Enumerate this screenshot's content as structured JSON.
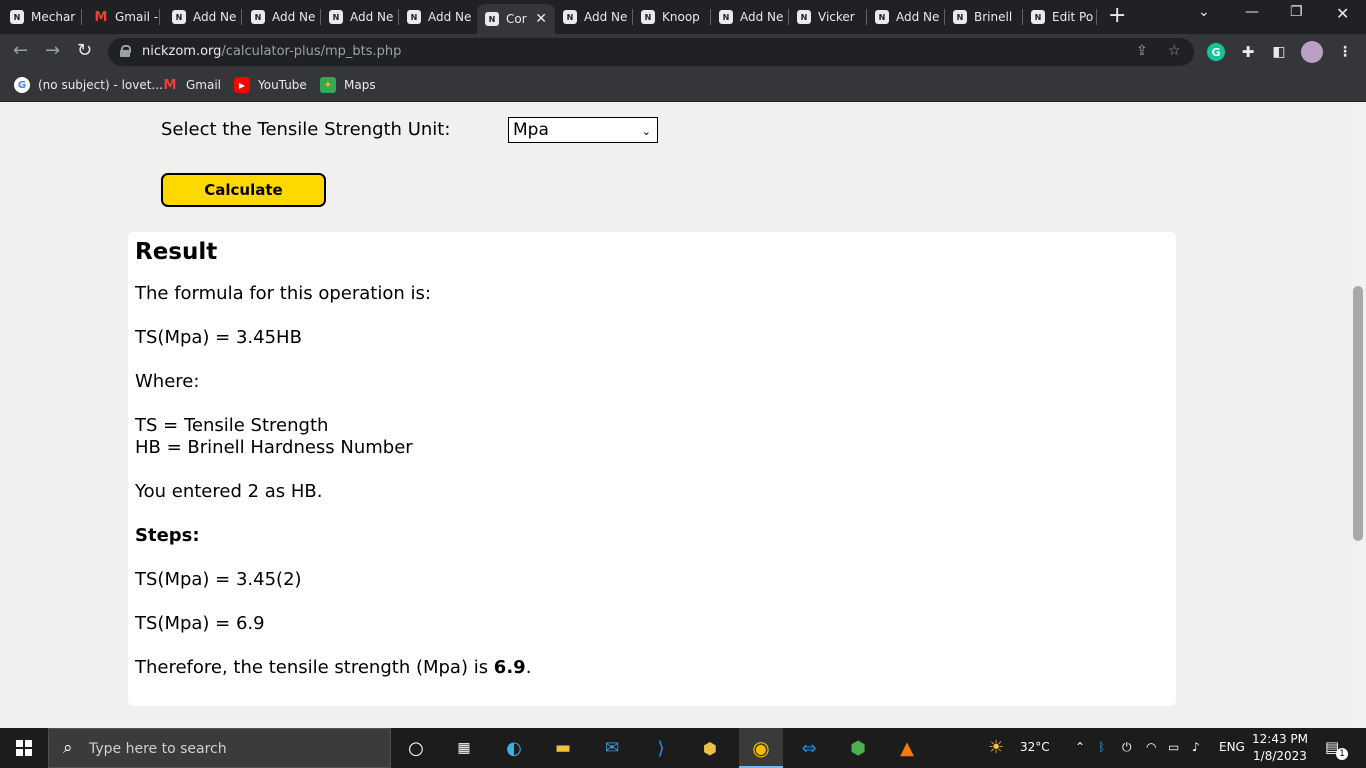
{
  "browser": {
    "tabs": [
      {
        "label": "Mechar",
        "icon": "nickzom"
      },
      {
        "label": "Gmail -",
        "icon": "gmail"
      },
      {
        "label": "Add Ne",
        "icon": "nickzom"
      },
      {
        "label": "Add Ne",
        "icon": "nickzom"
      },
      {
        "label": "Add Ne",
        "icon": "nickzom"
      },
      {
        "label": "Add Ne",
        "icon": "nickzom"
      },
      {
        "label": "Cor",
        "icon": "nickzom",
        "active": true
      },
      {
        "label": "Add Ne",
        "icon": "nickzom"
      },
      {
        "label": "Knoop",
        "icon": "nickzom"
      },
      {
        "label": "Add Ne",
        "icon": "nickzom"
      },
      {
        "label": "Vicker",
        "icon": "nickzom"
      },
      {
        "label": "Add Ne",
        "icon": "nickzom"
      },
      {
        "label": "Brinell",
        "icon": "nickzom"
      },
      {
        "label": "Edit Po",
        "icon": "nickzom"
      }
    ],
    "url_host": "nickzom.org",
    "url_path": "/calculator-plus/mp_bts.php",
    "bookmarks": [
      {
        "label": "(no subject) - lovet...",
        "icon": "google-icon"
      },
      {
        "label": "Gmail",
        "icon": "gmail-icon"
      },
      {
        "label": "YouTube",
        "icon": "youtube-icon"
      },
      {
        "label": "Maps",
        "icon": "maps-icon"
      }
    ]
  },
  "form": {
    "unit_label": "Select the Tensile Strength Unit:",
    "unit_selected": "Mpa",
    "calculate_label": "Calculate"
  },
  "result": {
    "heading": "Result",
    "formula_intro": "The formula for this operation is:",
    "formula": "TS(Mpa) = 3.45HB",
    "where": "Where:",
    "def_ts": "TS = Tensile Strength",
    "def_hb": "HB = Brinell Hardness Number",
    "entered": "You entered 2 as HB.",
    "steps_label": "Steps:",
    "step1": "TS(Mpa) = 3.45(2)",
    "step2": "TS(Mpa) = 6.9",
    "conclusion_prefix": "Therefore, the tensile strength (Mpa) is ",
    "conclusion_value": "6.9",
    "conclusion_suffix": "."
  },
  "taskbar": {
    "search_placeholder": "Type here to search",
    "weather": "32°C",
    "language": "ENG",
    "time": "12:43 PM",
    "date": "1/8/2023",
    "notification_count": "1"
  },
  "colors": {
    "accent_button": "#ffd800",
    "tab_bar": "#202124",
    "toolbar": "#35363a"
  }
}
